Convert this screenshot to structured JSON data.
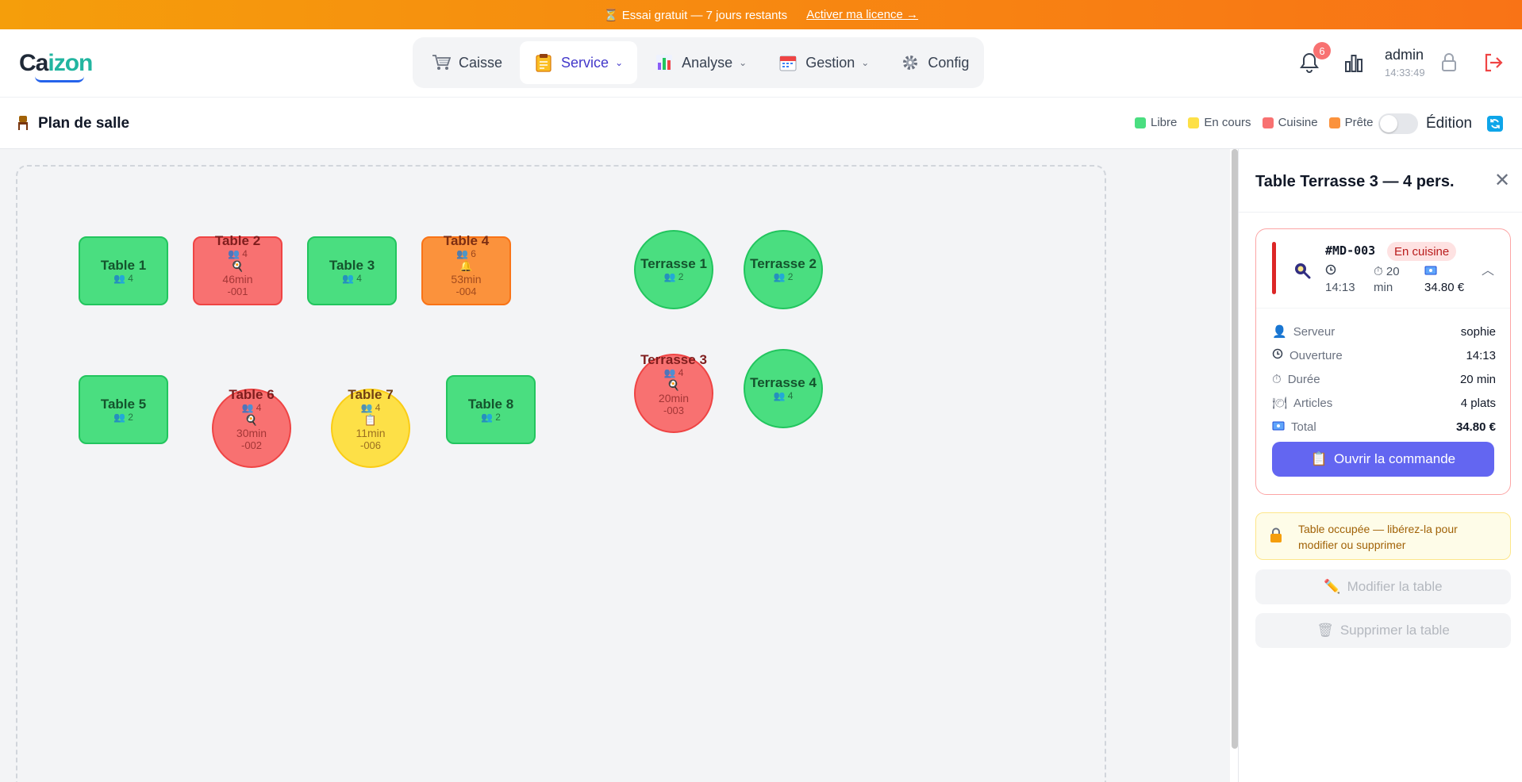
{
  "banner": {
    "text": "⏳ Essai gratuit — 7 jours restants",
    "link": "Activer ma licence →"
  },
  "brand": {
    "logo_part1": "Ca",
    "logo_part2": "izon"
  },
  "nav": {
    "items": [
      {
        "label": "Caisse",
        "icon": "cart-icon"
      },
      {
        "label": "Service",
        "icon": "clipboard-icon",
        "active": true
      },
      {
        "label": "Analyse",
        "icon": "bar-chart-icon"
      },
      {
        "label": "Gestion",
        "icon": "calendar-icon"
      },
      {
        "label": "Config",
        "icon": "gear-icon"
      }
    ]
  },
  "header": {
    "notifications": "6",
    "user": "admin",
    "time": "14:33:49"
  },
  "page": {
    "title": "Plan de salle",
    "edition_label": "Édition"
  },
  "legend": [
    {
      "label": "Libre",
      "color": "#4ade80"
    },
    {
      "label": "En cours",
      "color": "#fde047"
    },
    {
      "label": "Cuisine",
      "color": "#f87171"
    },
    {
      "label": "Prête",
      "color": "#fb923c"
    }
  ],
  "tables": {
    "t1": {
      "name": "Table 1",
      "covers": "👥 4"
    },
    "t2": {
      "name": "Table 2",
      "covers": "👥 4",
      "icon": "🍳",
      "time": "46min",
      "ref": "-001"
    },
    "t3": {
      "name": "Table 3",
      "covers": "👥 4"
    },
    "t4": {
      "name": "Table 4",
      "covers": "👥 6",
      "icon": "🔔",
      "time": "53min",
      "ref": "-004"
    },
    "t5": {
      "name": "Table 5",
      "covers": "👥 2"
    },
    "t6": {
      "name": "Table 6",
      "covers": "👥 4",
      "icon": "🍳",
      "time": "30min",
      "ref": "-002"
    },
    "t7": {
      "name": "Table 7",
      "covers": "👥 4",
      "icon": "📋",
      "time": "11min",
      "ref": "-006"
    },
    "t8": {
      "name": "Table 8",
      "covers": "👥 2"
    },
    "te1": {
      "name": "Terrasse 1",
      "covers": "👥 2"
    },
    "te2": {
      "name": "Terrasse 2",
      "covers": "👥 2"
    },
    "te3": {
      "name": "Terrasse 3",
      "covers": "👥 4",
      "icon": "🍳",
      "time": "20min",
      "ref": "-003"
    },
    "te4": {
      "name": "Terrasse 4",
      "covers": "👥 4"
    }
  },
  "panel": {
    "title": "Table Terrasse 3 — 4 pers.",
    "order": {
      "ref": "#MD-003",
      "status": "En cuisine",
      "time": "14:13",
      "duration_line1": "20",
      "duration_line2": "min",
      "total": "34.80 €"
    },
    "details": [
      {
        "key": "Serveur",
        "value": "sophie"
      },
      {
        "key": "Ouverture",
        "value": "14:13"
      },
      {
        "key": "Durée",
        "value": "20 min"
      },
      {
        "key": "Articles",
        "value": "4 plats"
      },
      {
        "key": "Total",
        "value": "34.80 €"
      }
    ],
    "open_button": "Ouvrir la commande",
    "warning": "Table occupée — libérez-la pour modifier ou supprimer",
    "edit_button": "Modifier la table",
    "delete_button": "Supprimer la table"
  }
}
